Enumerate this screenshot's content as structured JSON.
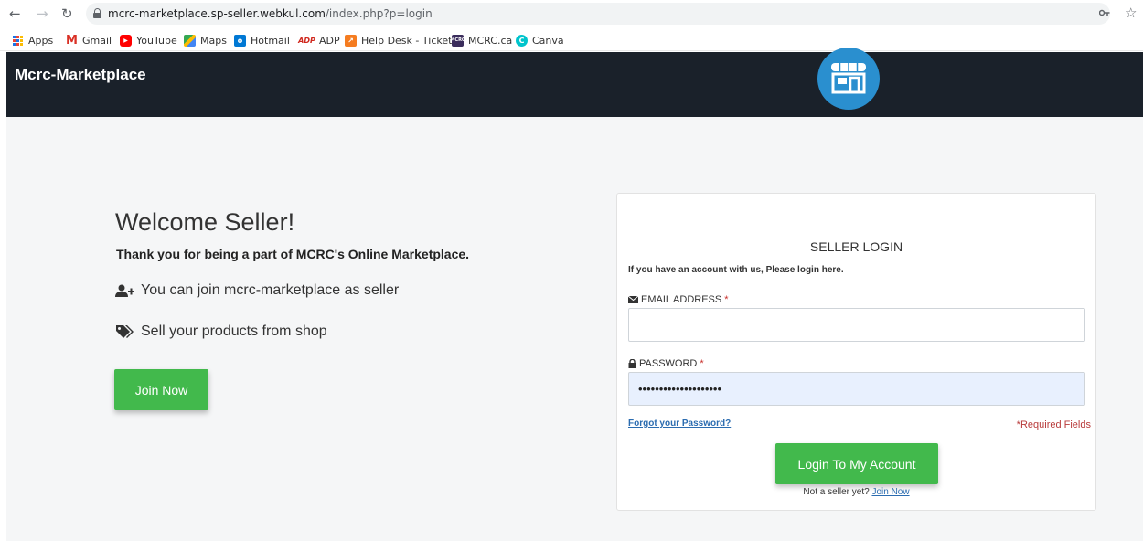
{
  "browser": {
    "url_host": "mcrc-marketplace.sp-seller.webkul.com",
    "url_path": "/index.php?p=login",
    "back_icon": "back-arrow-icon",
    "forward_icon": "forward-arrow-icon",
    "reload_icon": "reload-icon"
  },
  "bookmarks": [
    {
      "label": "Apps",
      "icon": "apps-grid-icon"
    },
    {
      "label": "Gmail",
      "icon": "gmail-icon",
      "color": "#d93025"
    },
    {
      "label": "YouTube",
      "icon": "youtube-icon",
      "color": "#ff0000"
    },
    {
      "label": "Maps",
      "icon": "maps-icon",
      "color": "#34a853"
    },
    {
      "label": "Hotmail",
      "icon": "outlook-icon",
      "color": "#0078d4"
    },
    {
      "label": "ADP",
      "icon": "adp-icon",
      "color": "#d0271d"
    },
    {
      "label": "Help Desk - Tickets",
      "icon": "helpdesk-icon",
      "color": "#f57c20"
    },
    {
      "label": "MCRC.ca",
      "icon": "mcrc-icon",
      "color": "#3b2d5c"
    },
    {
      "label": "Canva",
      "icon": "canva-icon",
      "color": "#00c4cc"
    }
  ],
  "header": {
    "title": "Mcrc-Marketplace",
    "background": "#1a212a"
  },
  "welcome": {
    "title": "Welcome Seller!",
    "subtitle": "Thank you for being a part of MCRC's Online Marketplace.",
    "features": [
      {
        "text": "You can join mcrc-marketplace as seller",
        "icon": "user-plus-icon"
      },
      {
        "text": "Sell your products from shop",
        "icon": "tags-icon"
      }
    ],
    "join_button": "Join Now"
  },
  "login": {
    "badge_icon": "storefront-icon",
    "badge_color": "#2a8fcf",
    "title": "SELLER LOGIN",
    "description": "If you have an account with us, Please login here.",
    "email_label": "EMAIL ADDRESS",
    "email_value": "",
    "password_label": "PASSWORD",
    "password_value": "••••••••••••••••••••",
    "required_mark": "*",
    "forgot_link": "Forgot your Password?",
    "required_note": "*Required Fields",
    "submit_button": "Login To My Account",
    "not_seller_text": "Not a seller yet?",
    "join_link": "Join Now",
    "button_color": "#42b94c"
  }
}
